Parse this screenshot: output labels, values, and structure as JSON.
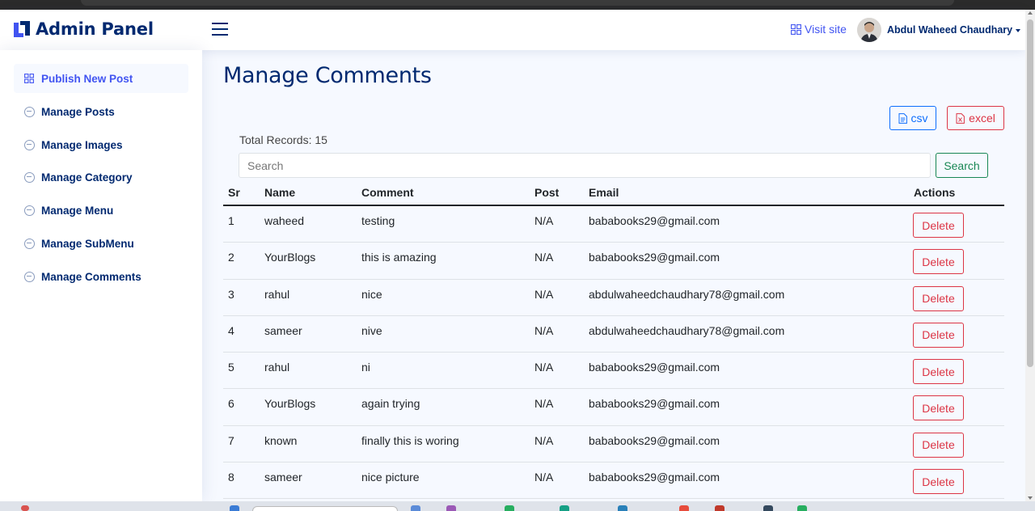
{
  "header": {
    "app_title": "Admin Panel",
    "visit_site_label": "Visit site",
    "user_name": "Abdul Waheed Chaudhary"
  },
  "sidebar": {
    "items": [
      {
        "label": "Publish New Post",
        "icon": "grid-icon",
        "active": true
      },
      {
        "label": "Manage Posts",
        "icon": "dash-circle-icon"
      },
      {
        "label": "Manage Images",
        "icon": "dash-circle-icon"
      },
      {
        "label": "Manage Category",
        "icon": "dash-circle-icon"
      },
      {
        "label": "Manage Menu",
        "icon": "dash-circle-icon"
      },
      {
        "label": "Manage SubMenu",
        "icon": "dash-circle-icon"
      },
      {
        "label": "Manage Comments",
        "icon": "dash-circle-icon"
      }
    ]
  },
  "main": {
    "title": "Manage Comments",
    "csv_label": "csv",
    "excel_label": "excel",
    "total_records": "Total Records: 15",
    "search_placeholder": "Search",
    "search_button": "Search"
  },
  "table": {
    "headers": [
      "Sr",
      "Name",
      "Comment",
      "Post",
      "Email",
      "Actions"
    ],
    "delete_label": "Delete",
    "rows": [
      {
        "sr": "1",
        "name": "waheed",
        "comment": "testing",
        "post": "N/A",
        "email": "bababooks29@gmail.com"
      },
      {
        "sr": "2",
        "name": "YourBlogs",
        "comment": "this is amazing",
        "post": "N/A",
        "email": "bababooks29@gmail.com"
      },
      {
        "sr": "3",
        "name": "rahul",
        "comment": "nice",
        "post": "N/A",
        "email": "abdulwaheedchaudhary78@gmail.com"
      },
      {
        "sr": "4",
        "name": "sameer",
        "comment": "nive",
        "post": "N/A",
        "email": "abdulwaheedchaudhary78@gmail.com"
      },
      {
        "sr": "5",
        "name": "rahul",
        "comment": "ni",
        "post": "N/A",
        "email": "bababooks29@gmail.com"
      },
      {
        "sr": "6",
        "name": "YourBlogs",
        "comment": "again trying",
        "post": "N/A",
        "email": "bababooks29@gmail.com"
      },
      {
        "sr": "7",
        "name": "known",
        "comment": "finally this is woring",
        "post": "N/A",
        "email": "bababooks29@gmail.com"
      },
      {
        "sr": "8",
        "name": "sameer",
        "comment": "nice picture",
        "post": "N/A",
        "email": "bababooks29@gmail.com"
      }
    ]
  },
  "colors": {
    "brand": "#012970",
    "accent": "#4154f1",
    "danger": "#dc3545",
    "success": "#198754",
    "primary": "#0d6efd"
  }
}
